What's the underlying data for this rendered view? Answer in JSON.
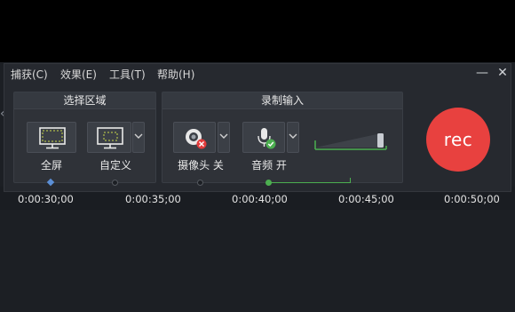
{
  "menu": [
    {
      "label": "捕获(C)"
    },
    {
      "label": "效果(E)"
    },
    {
      "label": "工具(T)"
    },
    {
      "label": "帮助(H)"
    }
  ],
  "window_controls": {
    "minimize": "—",
    "close": "✕"
  },
  "select_area": {
    "title": "选择区域",
    "fullscreen_label": "全屏",
    "custom_label": "自定义"
  },
  "recording_input": {
    "title": "录制输入",
    "camera_label": "摄像头 关",
    "audio_label": "音频 开"
  },
  "rec_button": {
    "label": "rec"
  },
  "timeline": {
    "timecodes": [
      "0:00:30;00",
      "0:00:35;00",
      "0:00:40;00",
      "0:00:45;00",
      "0:00:50;00"
    ]
  },
  "colors": {
    "rec": "#e8413f",
    "accent_green": "#4caf50",
    "marker_blue": "#5b8fd6",
    "panel": "#2f3238"
  },
  "icons": [
    "monitor-dashed-icon",
    "monitor-custom-icon",
    "webcam-off-icon",
    "microphone-on-icon",
    "chevron-down-icon"
  ]
}
